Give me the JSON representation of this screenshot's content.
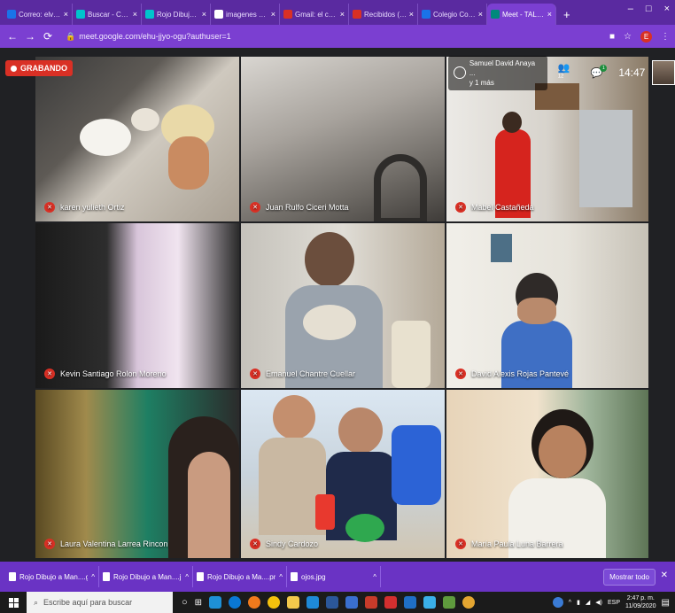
{
  "browser": {
    "tabs": [
      {
        "label": "Correo: elvira loren",
        "favicon_color": "#1a73e8",
        "active": false
      },
      {
        "label": "Buscar - Canva",
        "favicon_color": "#00c4cc",
        "active": false
      },
      {
        "label": "Rojo Dibujo a Mano",
        "favicon_color": "#00c4cc",
        "active": false
      },
      {
        "label": "imagenes animadas",
        "favicon_color": "#ffffff",
        "active": false
      },
      {
        "label": "Gmail: el correo ele",
        "favicon_color": "#d93025",
        "active": false
      },
      {
        "label": "Recibidos (454) - e",
        "favicon_color": "#d93025",
        "active": false
      },
      {
        "label": "Colegio Colombo S",
        "favicon_color": "#1a73e8",
        "active": false
      },
      {
        "label": "Meet - TALLER",
        "favicon_color": "#00897b",
        "active": true
      }
    ],
    "new_tab": "+",
    "url": "meet.google.com/ehu-jjyo-ogu?authuser=1",
    "profile_initial": "E"
  },
  "meet": {
    "recording_label": "GRABANDO",
    "presenter_line1": "Samuel David Anaya ...",
    "presenter_line2": "y 1 más",
    "participant_count": "12",
    "chat_badge": "1",
    "clock": "14:47",
    "tiles": [
      {
        "name": "karen yulieth Ortiz",
        "scene": "kitchen-counter"
      },
      {
        "name": "Juan Rulfo Ciceri Motta",
        "scene": "gray-fabric"
      },
      {
        "name": "Mabel Castañeda",
        "scene": "kitchen-red"
      },
      {
        "name": "Kevin Santiago Rolon Moreno",
        "scene": "curtain-dark"
      },
      {
        "name": "Emanuel Chantre Cuellar",
        "scene": "boy-dough"
      },
      {
        "name": "David Alexis Rojas Pantevé",
        "scene": "boy-blue"
      },
      {
        "name": "Laura Valentina Larrea Rincon",
        "scene": "living-room"
      },
      {
        "name": "Sindy Cardozo",
        "scene": "kids-table"
      },
      {
        "name": "María Paula Luna Barrera",
        "scene": "girl-glasses"
      }
    ]
  },
  "downloads": {
    "items": [
      {
        "label": "Rojo Dibujo a Man....gif"
      },
      {
        "label": "Rojo Dibujo a Man....jpg"
      },
      {
        "label": "Rojo Dibujo a Ma....png"
      },
      {
        "label": "ojos.jpg"
      }
    ],
    "show_all": "Mostrar todo"
  },
  "taskbar": {
    "search_placeholder": "Escribe aquí para buscar",
    "language": "ESP",
    "time": "2:47 p. m.",
    "date": "11/09/2020"
  }
}
